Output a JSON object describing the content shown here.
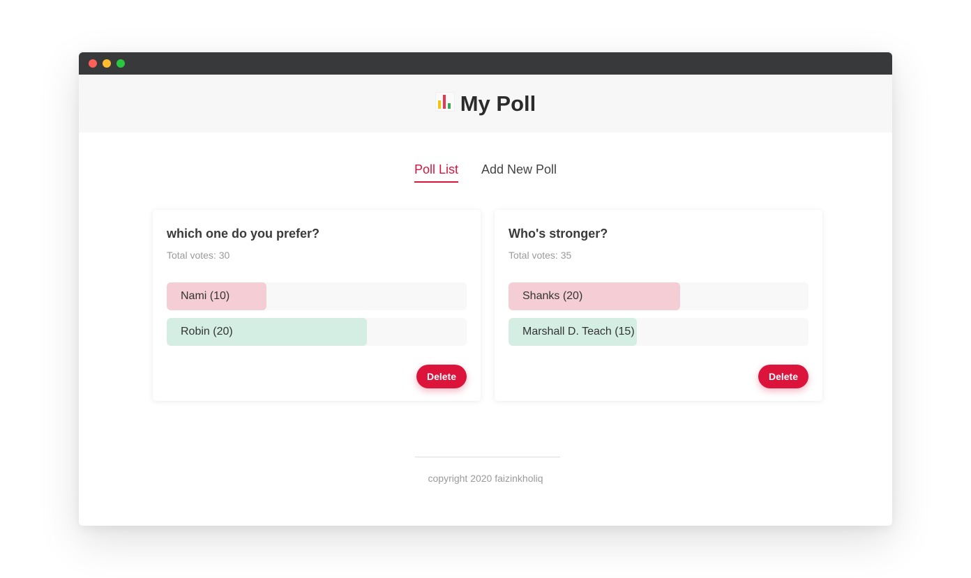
{
  "colors": {
    "accent": "#dc143c",
    "option_red": "#f5cdd5",
    "option_green": "#d4eee4",
    "dot_close": "#fe5f57",
    "dot_min": "#febc2e",
    "dot_max": "#28c840"
  },
  "header": {
    "icon": "bar-chart-icon",
    "title": "My Poll"
  },
  "tabs": [
    {
      "label": "Poll List",
      "active": true
    },
    {
      "label": "Add New Poll",
      "active": false
    }
  ],
  "polls": [
    {
      "question": "which one do you prefer?",
      "total": "Total votes: 30",
      "options": [
        {
          "label": "Nami (10)",
          "fraction": 0.333,
          "color": "#f5cdd5"
        },
        {
          "label": "Robin (20)",
          "fraction": 0.667,
          "color": "#d4eee4"
        }
      ],
      "delete_label": "Delete"
    },
    {
      "question": "Who's stronger?",
      "total": "Total votes: 35",
      "options": [
        {
          "label": "Shanks (20)",
          "fraction": 0.571,
          "color": "#f5cdd5"
        },
        {
          "label": "Marshall D. Teach (15)",
          "fraction": 0.429,
          "color": "#d4eee4"
        }
      ],
      "delete_label": "Delete"
    }
  ],
  "footer": {
    "copyright": "copyright 2020 faizinkholiq"
  }
}
